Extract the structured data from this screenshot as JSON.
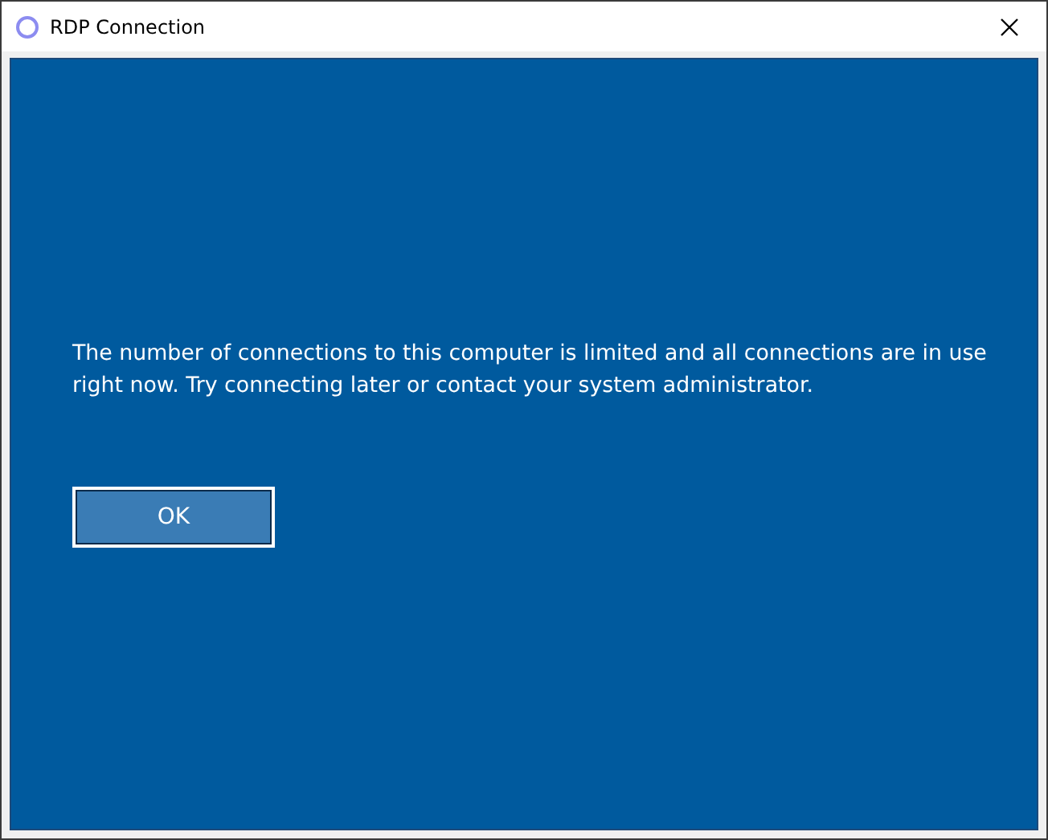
{
  "window": {
    "title": "RDP Connection"
  },
  "message": "The number of connections to this computer is limited and all connections are in use right now. Try connecting later or contact your system administrator.",
  "buttons": [
    "OK"
  ]
}
